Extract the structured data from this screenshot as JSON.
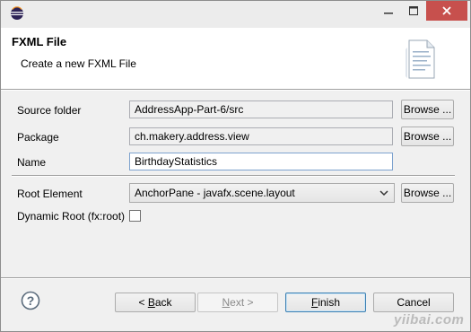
{
  "window": {
    "title": ""
  },
  "header": {
    "title": "FXML File",
    "subtitle": "Create a new FXML File"
  },
  "form": {
    "source_folder": {
      "label": "Source folder",
      "value": "AddressApp-Part-6/src",
      "button": "Browse ..."
    },
    "package": {
      "label": "Package",
      "value": "ch.makery.address.view",
      "button": "Browse ..."
    },
    "name": {
      "label": "Name",
      "value": "BirthdayStatistics"
    },
    "root_element": {
      "label": "Root Element",
      "value": "AnchorPane - javafx.scene.layout",
      "button": "Browse ..."
    },
    "dynamic_root": {
      "label": "Dynamic Root (fx:root)",
      "checked": false
    }
  },
  "footer": {
    "back_prefix": "< ",
    "back_mnemonic": "B",
    "back_rest": "ack",
    "next_prefix": "",
    "next_mnemonic": "N",
    "next_rest": "ext >",
    "finish_mnemonic": "F",
    "finish_rest": "inish",
    "cancel": "Cancel"
  },
  "watermark": "yiibai.com",
  "colors": {
    "close_button": "#c7504d",
    "header_bg": "#ffffff",
    "dialog_bg": "#f0f0f0"
  },
  "icons": {
    "app": "eclipse-icon",
    "wizard": "document-icon",
    "help": "help-icon",
    "dropdown": "chevron-down-icon"
  }
}
